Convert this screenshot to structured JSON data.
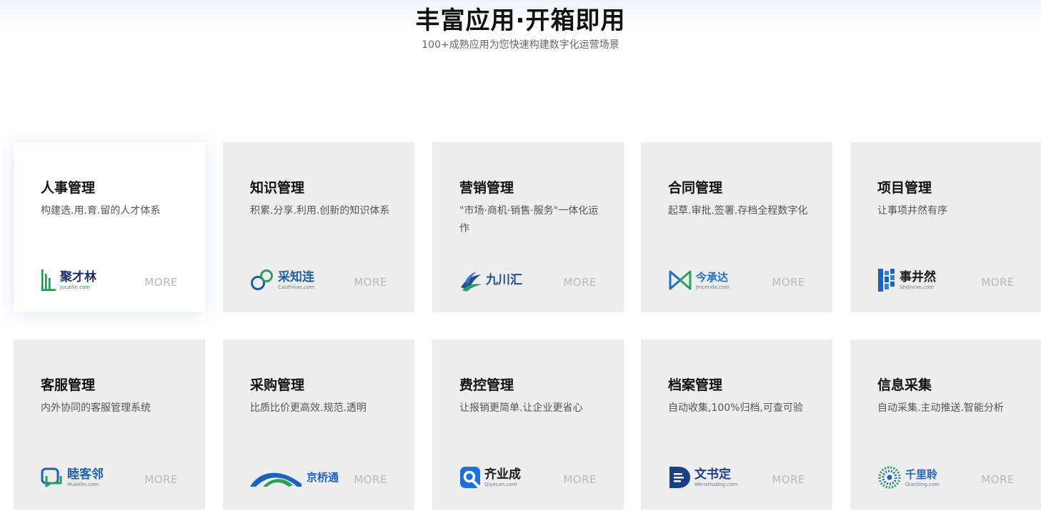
{
  "header": {
    "title": "丰富应用·开箱即用",
    "subtitle": "100+成熟应用为您快速构建数字化运营场景"
  },
  "more_label": "MORE",
  "cards": [
    {
      "title": "人事管理",
      "desc": "构建选.用.育.留的人才体系",
      "logo_name": "聚才林",
      "logo_domain": "Jucailin.com",
      "logo_icon": "bars-leaf-icon",
      "brand_color": "#1a9a4a"
    },
    {
      "title": "知识管理",
      "desc": "积累.分享.利用.创新的知识体系",
      "logo_name": "采知连",
      "logo_domain": "Caizhilian.com",
      "logo_icon": "linked-rings-icon",
      "brand_color": "#1e5fa8"
    },
    {
      "title": "营销管理",
      "desc": "\"市场·商机·销售·服务\"一体化运作",
      "logo_name": "九川汇",
      "logo_domain": "",
      "logo_icon": "wave-icon",
      "brand_color": "#1e4f9a"
    },
    {
      "title": "合同管理",
      "desc": "起草.审批.签署.存档全程数字化",
      "logo_name": "今承达",
      "logo_domain": "Jincenda.com",
      "logo_icon": "bowtie-icon",
      "brand_color": "#1f6fc6"
    },
    {
      "title": "项目管理",
      "desc": "让事项井然有序",
      "logo_name": "事井然",
      "logo_domain": "Shijinran.com",
      "logo_icon": "block-grid-icon",
      "brand_color": "#1a62c2"
    },
    {
      "title": "客服管理",
      "desc": "内外协同的客服管理系统",
      "logo_name": "睦客邻",
      "logo_domain": "Mukelin.com",
      "logo_icon": "chat-bubble-icon",
      "brand_color": "#1b64b4"
    },
    {
      "title": "采购管理",
      "desc": "比质比价更高效.规范.透明",
      "logo_name": "京桥通",
      "logo_domain": "",
      "logo_icon": "bridge-icon",
      "brand_color": "#1a63c0"
    },
    {
      "title": "费控管理",
      "desc": "让报销更简单.让企业更省心",
      "logo_name": "齐业成",
      "logo_domain": "Qiyecan.com",
      "logo_icon": "q-square-icon",
      "brand_color": "#1f6fd8"
    },
    {
      "title": "档案管理",
      "desc": "自动收集,100%归档,可查可验",
      "logo_name": "文书定",
      "logo_domain": "Wenshuding.com",
      "logo_icon": "document-d-icon",
      "brand_color": "#1a3f86"
    },
    {
      "title": "信息采集",
      "desc": "自动采集.主动推送.智能分析",
      "logo_name": "千里聆",
      "logo_domain": "Qianliing.com",
      "logo_icon": "dotted-circle-icon",
      "brand_color": "#1e67b8"
    }
  ]
}
